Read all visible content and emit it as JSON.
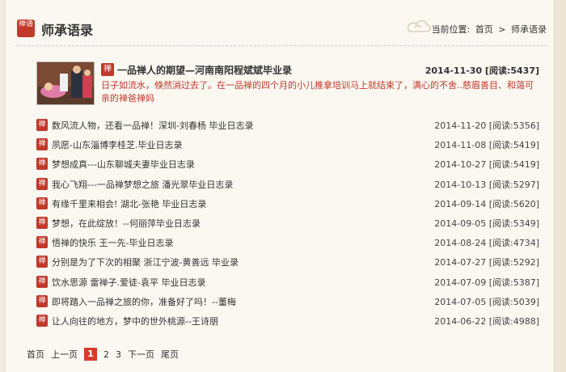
{
  "header": {
    "logo_text": "禅语",
    "title": "师承语录",
    "breadcrumb_label": "当前位置:",
    "breadcrumb_home": "首页",
    "breadcrumb_sep": ">",
    "breadcrumb_current": "师承语录"
  },
  "featured": {
    "icon": "禅",
    "title": "一品禅人的期望—河南南阳程斌斌毕业录",
    "meta": "2014-11-30 [阅读:5437]",
    "summary": "日子如流水，倏然消过去了。在一品禅的四个月的小儿推拿培训马上就结束了，满心的不舍..慈眉善目、和蔼可亲的禅爸禅妈"
  },
  "list": {
    "icon": "禅",
    "items": [
      {
        "title": "数风流人物，还看一品禅！深圳-刘春杨 毕业日志录",
        "meta": "2014-11-20 [阅读:5356]"
      },
      {
        "title": "夙愿-山东淄博李桂芝.毕业日志录",
        "meta": "2014-11-08 [阅读:5419]"
      },
      {
        "title": "梦想成真---山东聊城夫妻毕业日志录",
        "meta": "2014-10-27 [阅读:5419]"
      },
      {
        "title": "我心飞翔---一品禅梦想之旅 潘光翠毕业日志录",
        "meta": "2014-10-13 [阅读:5297]"
      },
      {
        "title": "有缘千里来相会! 湖北-张艳 毕业日志录",
        "meta": "2014-09-14 [阅读:5620]"
      },
      {
        "title": "梦想，在此绽放！--何丽萍毕业日志录",
        "meta": "2014-09-05 [阅读:5349]"
      },
      {
        "title": "悟禅的快乐 王一先-毕业日志录",
        "meta": "2014-08-24 [阅读:4734]"
      },
      {
        "title": "分别是为了下次的相聚 浙江宁波-黄善远 毕业录",
        "meta": "2014-07-27 [阅读:5292]"
      },
      {
        "title": "饮水思源 雷禅子.爱徒-袁平 毕业日志录",
        "meta": "2014-07-09 [阅读:5387]"
      },
      {
        "title": "即将踏入一品禅之旅的你，准备好了吗！--董梅",
        "meta": "2014-07-05 [阅读:5039]"
      },
      {
        "title": "让人向往的地方，梦中的世外桃源--王诗朋",
        "meta": "2014-06-22 [阅读:4988]"
      }
    ]
  },
  "pager": {
    "first": "首页",
    "prev": "上一页",
    "current": "1",
    "pages": [
      "2",
      "3"
    ],
    "next": "下一页",
    "last": "尾页"
  },
  "colors": {
    "accent": "#c0392b",
    "summary": "#c0392b",
    "background": "#fbf8f1"
  }
}
